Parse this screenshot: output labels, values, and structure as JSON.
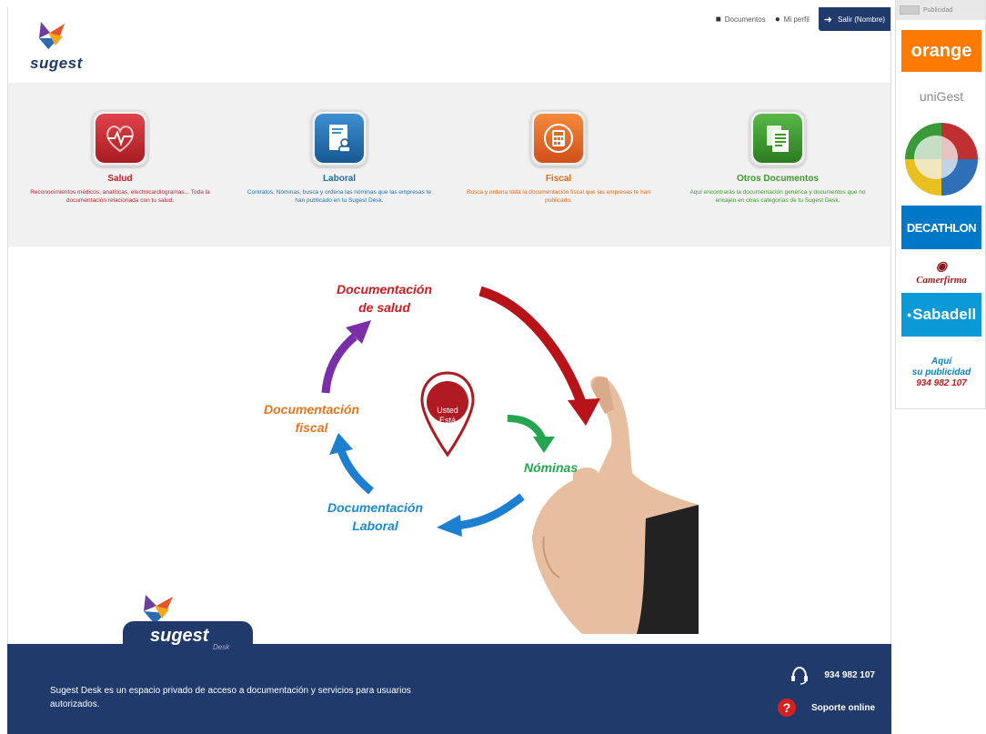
{
  "header": {
    "logo_text": "sugest",
    "nav": {
      "documents": "Documentos",
      "profile": "Mi perfil",
      "logout": "Salir (Nombre)"
    }
  },
  "categories": [
    {
      "title": "Salud",
      "color": "#c0242b",
      "description": "Reconocimientos médicos, analíticas, electrocardiogramas... Toda la documentación relacionada con tu salud.",
      "icon": "heartbeat-icon"
    },
    {
      "title": "Laboral",
      "color": "#1f6fb0",
      "description": "Contratos, Nóminas, busca y ordena las nóminas que las empresas te han publicado en tu Sugest Desk.",
      "icon": "id-card-icon"
    },
    {
      "title": "Fiscal",
      "color": "#e06a1a",
      "description": "Busca y ordena toda la documentación fiscal que las empresas te han publicado.",
      "icon": "calculator-icon"
    },
    {
      "title": "Otros Documentos",
      "color": "#3c9a2b",
      "description": "Aquí encontrarás la documentación genérica y documentos que no encajen en otras categorías de tu Sugest Desk.",
      "icon": "documents-icon"
    }
  ],
  "cycle": {
    "salud": [
      "Documentación",
      "de salud"
    ],
    "fiscal": [
      "Documentación",
      "fiscal"
    ],
    "nominas": "Nóminas",
    "laboral": [
      "Documentación",
      "Laboral"
    ],
    "pin": [
      "Usted",
      "Está",
      "aquí"
    ]
  },
  "footer": {
    "logo_text": "sugest",
    "logo_sub": "Desk",
    "description": "Sugest Desk es un espacio privado de acceso a documentación y servicios para usuarios autorizados.",
    "phone": "934 982 107",
    "support": "Soporte online"
  },
  "sidebar": {
    "header": "Publicidad",
    "ads": {
      "orange": "orange",
      "unigest": "uniGest",
      "decathlon": "DECATHLON",
      "camerfirma": "Camerfirma",
      "sabadell": "Sabadell",
      "promo": [
        "Aquí",
        "su publicidad",
        "934 982 107"
      ]
    }
  }
}
